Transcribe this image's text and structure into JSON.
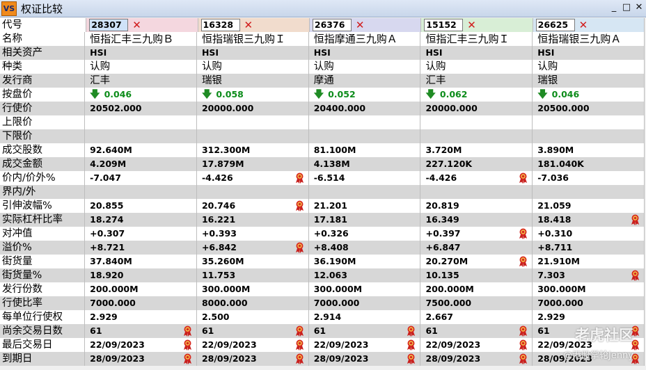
{
  "window": {
    "title": "权证比较",
    "icon_text": "VS",
    "minimize": "_",
    "maximize": "□",
    "close": "✕"
  },
  "header_colors": [
    "#f4d7df",
    "#f1dccd",
    "#d7d8ef",
    "#d8eed6",
    "#d6e6f3"
  ],
  "labels": [
    "代号",
    "名称",
    "相关资产",
    "种类",
    "发行商",
    "按盘价",
    "行使价",
    "上限价",
    "下限价",
    "成交股数",
    "成交金额",
    "价内/价外%",
    "界内/外",
    "引伸波幅%",
    "实际杠杆比率",
    "对冲值",
    "溢价%",
    "街货量",
    "街货量%",
    "发行份数",
    "行使比率",
    "每单位行使权",
    "尚余交易日数",
    "最后交易日",
    "到期日"
  ],
  "warrants": [
    {
      "code": "28307",
      "name": "恒指汇丰三九购Ｂ",
      "asset": "HSI",
      "type": "认购",
      "issuer": "汇丰",
      "price": "0.046",
      "strike": "20502.000",
      "upper": "",
      "lower": "",
      "shares": "92.640M",
      "turnover": "4.209M",
      "moneyness": "-7.047",
      "inout": "",
      "iv": "20.855",
      "gearing": "18.274",
      "delta": "+0.307",
      "premium": "+8.721",
      "os_qty": "37.840M",
      "os_pct": "18.920",
      "issue_size": "200.000M",
      "ratio": "7000.000",
      "per_unit": "2.929",
      "days_left": "61",
      "last_trade": "22/09/2023",
      "expiry": "28/09/2023"
    },
    {
      "code": "16328",
      "name": "恒指瑞银三九购Ｉ",
      "asset": "HSI",
      "type": "认购",
      "issuer": "瑞银",
      "price": "0.058",
      "strike": "20000.000",
      "upper": "",
      "lower": "",
      "shares": "312.300M",
      "turnover": "17.879M",
      "moneyness": "-4.426",
      "inout": "",
      "iv": "20.746",
      "gearing": "16.221",
      "delta": "+0.393",
      "premium": "+6.842",
      "os_qty": "35.260M",
      "os_pct": "11.753",
      "issue_size": "300.000M",
      "ratio": "8000.000",
      "per_unit": "2.500",
      "days_left": "61",
      "last_trade": "22/09/2023",
      "expiry": "28/09/2023"
    },
    {
      "code": "26376",
      "name": "恒指摩通三九购Ａ",
      "asset": "HSI",
      "type": "认购",
      "issuer": "摩通",
      "price": "0.052",
      "strike": "20400.000",
      "upper": "",
      "lower": "",
      "shares": "81.100M",
      "turnover": "4.138M",
      "moneyness": "-6.514",
      "inout": "",
      "iv": "21.201",
      "gearing": "17.181",
      "delta": "+0.326",
      "premium": "+8.408",
      "os_qty": "36.190M",
      "os_pct": "12.063",
      "issue_size": "300.000M",
      "ratio": "7000.000",
      "per_unit": "2.914",
      "days_left": "61",
      "last_trade": "22/09/2023",
      "expiry": "28/09/2023"
    },
    {
      "code": "15152",
      "name": "恒指汇丰三九购Ｉ",
      "asset": "HSI",
      "type": "认购",
      "issuer": "汇丰",
      "price": "0.062",
      "strike": "20000.000",
      "upper": "",
      "lower": "",
      "shares": "3.720M",
      "turnover": "227.120K",
      "moneyness": "-4.426",
      "inout": "",
      "iv": "20.819",
      "gearing": "16.349",
      "delta": "+0.397",
      "premium": "+6.847",
      "os_qty": "20.270M",
      "os_pct": "10.135",
      "issue_size": "200.000M",
      "ratio": "7500.000",
      "per_unit": "2.667",
      "days_left": "61",
      "last_trade": "22/09/2023",
      "expiry": "28/09/2023"
    },
    {
      "code": "26625",
      "name": "恒指瑞银三九购Ａ",
      "asset": "HSI",
      "type": "认购",
      "issuer": "瑞银",
      "price": "0.046",
      "strike": "20500.000",
      "upper": "",
      "lower": "",
      "shares": "3.890M",
      "turnover": "181.040K",
      "moneyness": "-7.036",
      "inout": "",
      "iv": "21.059",
      "gearing": "18.418",
      "delta": "+0.310",
      "premium": "+8.711",
      "os_qty": "21.910M",
      "os_pct": "7.303",
      "issue_size": "300.000M",
      "ratio": "7000.000",
      "per_unit": "2.929",
      "days_left": "61",
      "last_trade": "22/09/2023",
      "expiry": "28/09/2023"
    }
  ],
  "medals": {
    "moneyness": [
      1,
      3
    ],
    "iv": [
      1
    ],
    "gearing": [
      4
    ],
    "delta": [
      3
    ],
    "premium": [
      1
    ],
    "os_qty": [
      3
    ],
    "os_pct": [
      4
    ],
    "days_left": [
      0,
      1,
      2,
      3,
      4
    ],
    "last_trade": [
      0,
      1,
      2,
      3,
      4
    ],
    "expiry": [
      0,
      1,
      2,
      3,
      4
    ]
  },
  "watermark": {
    "line1": "老虎社区",
    "line2": "@港股掌轮Jenny"
  }
}
